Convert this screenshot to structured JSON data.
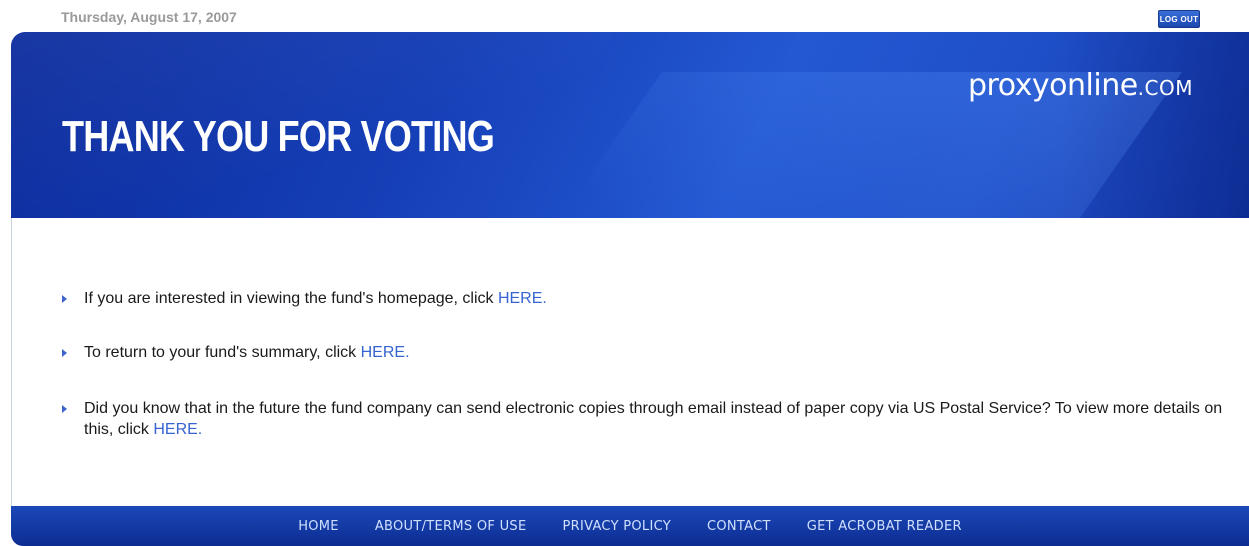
{
  "header": {
    "date": "Thursday, August 17, 2007",
    "logout_label": "LOG OUT"
  },
  "banner": {
    "brand_main": "proxyonline",
    "brand_suffix": ".COM",
    "headline": "THANK YOU FOR VOTING"
  },
  "items": [
    {
      "text": "If you are interested in viewing the fund's homepage, click ",
      "link": "HERE",
      "after": "."
    },
    {
      "text": "To return to your fund's summary, click ",
      "link": "HERE",
      "after": "."
    },
    {
      "text": "Did you know that in the future the fund company can send electronic copies through email instead of paper copy via US Postal Service? To view more details on this, click ",
      "link": "HERE",
      "after": "."
    }
  ],
  "footer": {
    "links": [
      "HOME",
      "ABOUT/TERMS OF USE",
      "PRIVACY POLICY",
      "CONTACT",
      "GET ACROBAT READER"
    ]
  },
  "colors": {
    "banner": "#1640b8",
    "link": "#3564d1",
    "footer": "#1b48b8"
  }
}
